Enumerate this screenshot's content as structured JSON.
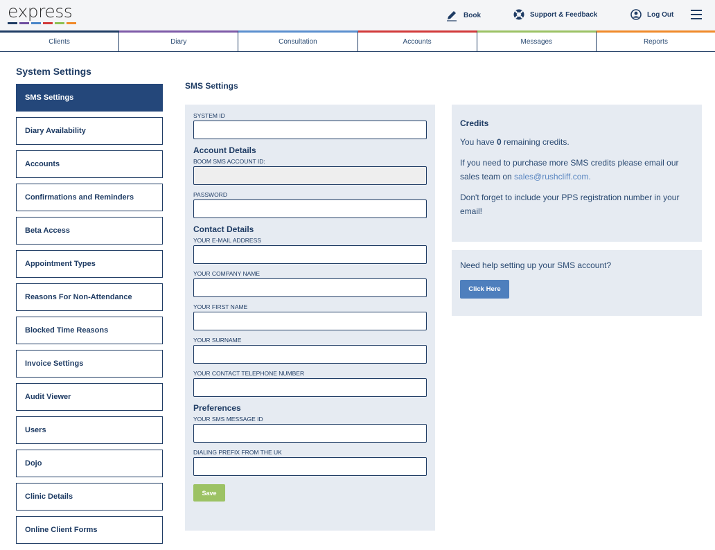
{
  "brand": {
    "logo_text": "express",
    "bar_colors": [
      "#1f3c64",
      "#6f4fa0",
      "#4a86c8",
      "#d23a3a",
      "#8cc152",
      "#f08a2a"
    ]
  },
  "header": {
    "book_label": "Book",
    "support_label": "Support & Feedback",
    "logout_label": "Log Out"
  },
  "nav": {
    "tabs": [
      {
        "label": "Clients",
        "color": "#1f3c64"
      },
      {
        "label": "Diary",
        "color": "#7e5aa8"
      },
      {
        "label": "Consultation",
        "color": "#5b8fcf"
      },
      {
        "label": "Accounts",
        "color": "#d23a3a"
      },
      {
        "label": "Messages",
        "color": "#9cc264"
      },
      {
        "label": "Reports",
        "color": "#f08a2a"
      }
    ]
  },
  "sidebar": {
    "title": "System Settings",
    "items": [
      {
        "label": "SMS Settings",
        "active": true
      },
      {
        "label": "Diary Availability"
      },
      {
        "label": "Accounts"
      },
      {
        "label": "Confirmations and Reminders"
      },
      {
        "label": "Beta Access"
      },
      {
        "label": "Appointment Types"
      },
      {
        "label": "Reasons For Non-Attendance"
      },
      {
        "label": "Blocked Time Reasons"
      },
      {
        "label": "Invoice Settings"
      },
      {
        "label": "Audit Viewer"
      },
      {
        "label": "Users"
      },
      {
        "label": "Dojo"
      },
      {
        "label": "Clinic Details"
      },
      {
        "label": "Online Client Forms"
      }
    ]
  },
  "main": {
    "title": "SMS Settings",
    "form": {
      "system_id_label": "SYSTEM ID",
      "system_id_value": "",
      "account_heading": "Account Details",
      "boom_label": "BOOM SMS ACCOUNT ID:",
      "boom_value": "",
      "password_label": "PASSWORD",
      "password_value": "",
      "contact_heading": "Contact Details",
      "email_label": "YOUR E-MAIL ADDRESS",
      "email_value": "",
      "company_label": "YOUR COMPANY NAME",
      "company_value": "",
      "first_name_label": "YOUR FIRST NAME",
      "first_name_value": "",
      "surname_label": "YOUR SURNAME",
      "surname_value": "",
      "phone_label": "YOUR CONTACT TELEPHONE NUMBER",
      "phone_value": "",
      "preferences_heading": "Preferences",
      "message_id_label": "YOUR SMS MESSAGE ID",
      "message_id_value": "",
      "prefix_label": "DIALING PREFIX FROM THE UK",
      "prefix_value": "",
      "save_label": "Save"
    },
    "credits": {
      "heading": "Credits",
      "you_have": "You have ",
      "count": "0",
      "remaining": " remaining credits.",
      "purchase_text": "If you need to purchase more SMS credits please email our sales team on ",
      "email_link": "sales@rushcliff.com.",
      "pps_text": "Don't forget to include your PPS registration number in your email!"
    },
    "help": {
      "text": "Need help setting up your SMS account?",
      "button_label": "Click Here"
    }
  }
}
